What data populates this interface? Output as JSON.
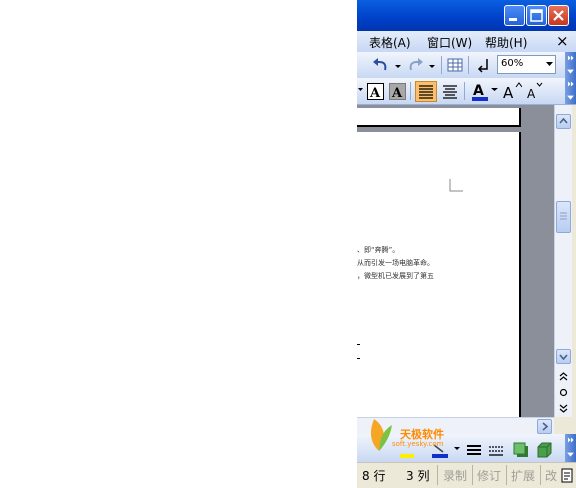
{
  "menubar": {
    "items": [
      "表格(A)",
      "窗口(W)",
      "帮助(H)"
    ],
    "close": "×"
  },
  "toolbar": {
    "zoom": "60%"
  },
  "document": {
    "lines": [
      "、即“奔腾”。",
      "从而引发一场电脑革命。",
      "，微型机已发展到了第五"
    ]
  },
  "watermark": {
    "text": "天极软件",
    "url": "soft.yesky.com"
  },
  "statusbar": {
    "line": "8 行",
    "col": "3 列",
    "rec": "录制",
    "trk": "修订",
    "ext": "扩展",
    "ovr": "改"
  },
  "colors": {
    "title_blue": "#0052e0",
    "menu_bg": "#d4e1f7",
    "doc_gray": "#8a8f99"
  }
}
